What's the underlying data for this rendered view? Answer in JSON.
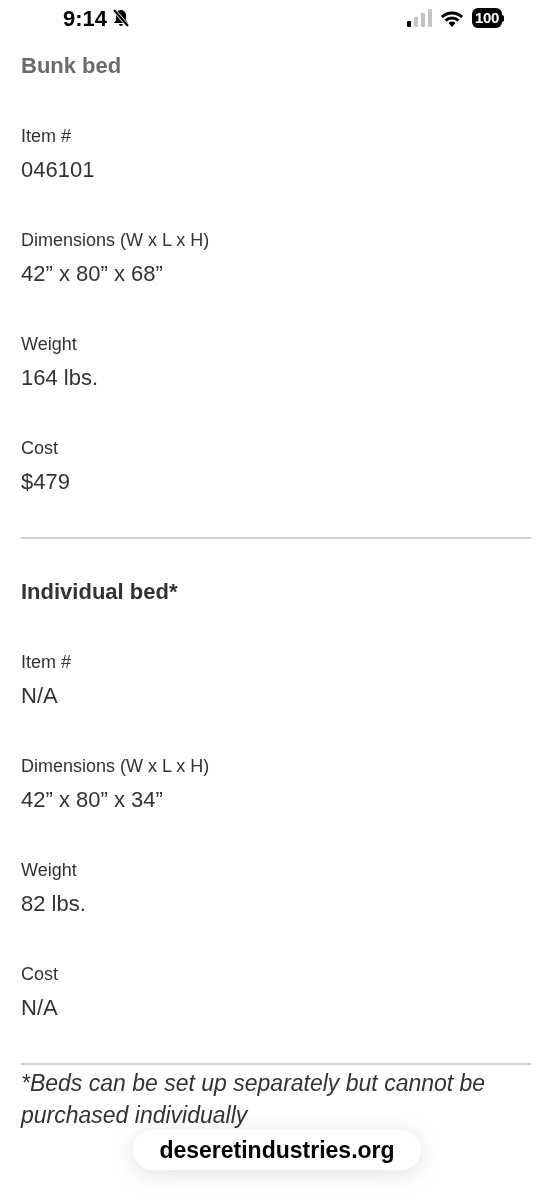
{
  "status_bar": {
    "time": "9:14",
    "battery": "100"
  },
  "sections": [
    {
      "title": "Bunk bed",
      "dimmed": true,
      "fields": [
        {
          "label": "Item #",
          "value": "046101"
        },
        {
          "label": "Dimensions (W x L x H)",
          "value": "42” x 80” x 68”"
        },
        {
          "label": "Weight",
          "value": "164 lbs."
        },
        {
          "label": "Cost",
          "value": "$479"
        }
      ]
    },
    {
      "title": "Individual bed*",
      "dimmed": false,
      "fields": [
        {
          "label": "Item #",
          "value": "N/A"
        },
        {
          "label": "Dimensions (W x L x H)",
          "value": "42” x 80” x 34”"
        },
        {
          "label": "Weight",
          "value": "82 lbs."
        },
        {
          "label": "Cost",
          "value": "N/A"
        }
      ]
    }
  ],
  "footnote": "*Beds can be set up separately but cannot be purchased individually",
  "url_bar": {
    "domain": "deseretindustries.org"
  }
}
